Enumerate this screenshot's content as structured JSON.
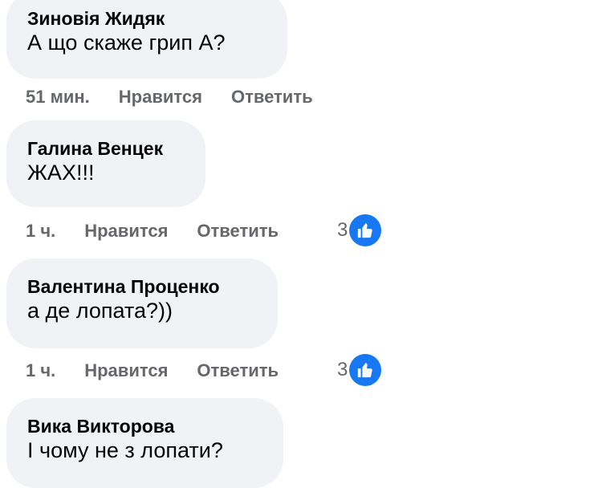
{
  "comments": [
    {
      "author": "Зиновія Жидяк",
      "text": "А що скаже грип А?",
      "time": "51 мин.",
      "like_label": "Нравится",
      "reply_label": "Ответить",
      "reaction_count": ""
    },
    {
      "author": "Галина Венцек",
      "text": "ЖАХ!!!",
      "time": "1 ч.",
      "like_label": "Нравится",
      "reply_label": "Ответить",
      "reaction_count": "3"
    },
    {
      "author": "Валентина Проценко",
      "text": "а де лопата?))",
      "time": "1 ч.",
      "like_label": "Нравится",
      "reply_label": "Ответить",
      "reaction_count": "3"
    },
    {
      "author": "Вика Викторова",
      "text": "І чому не з лопати?",
      "time": "",
      "like_label": "",
      "reply_label": "",
      "reaction_count": ""
    }
  ],
  "icons": {
    "reaction": "like-icon"
  },
  "colors": {
    "bubble": "#f0f2f5",
    "action_text": "#65676b",
    "like_badge": "#1877f2"
  }
}
